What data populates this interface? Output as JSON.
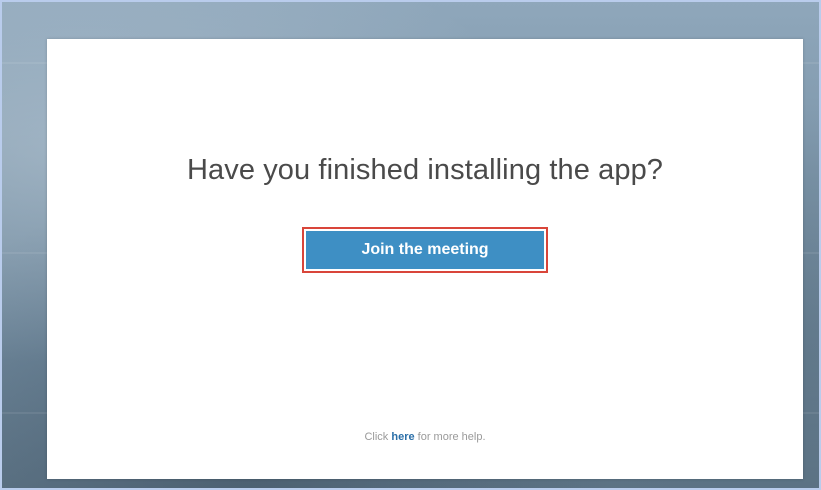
{
  "dialog": {
    "heading": "Have you finished installing the app?",
    "join_button_label": "Join the meeting",
    "help_prefix": "Click ",
    "help_link": "here",
    "help_suffix": " for more help."
  },
  "colors": {
    "button_bg": "#3e8fc4",
    "highlight_border": "#d9453a",
    "link": "#2b6fa8"
  }
}
